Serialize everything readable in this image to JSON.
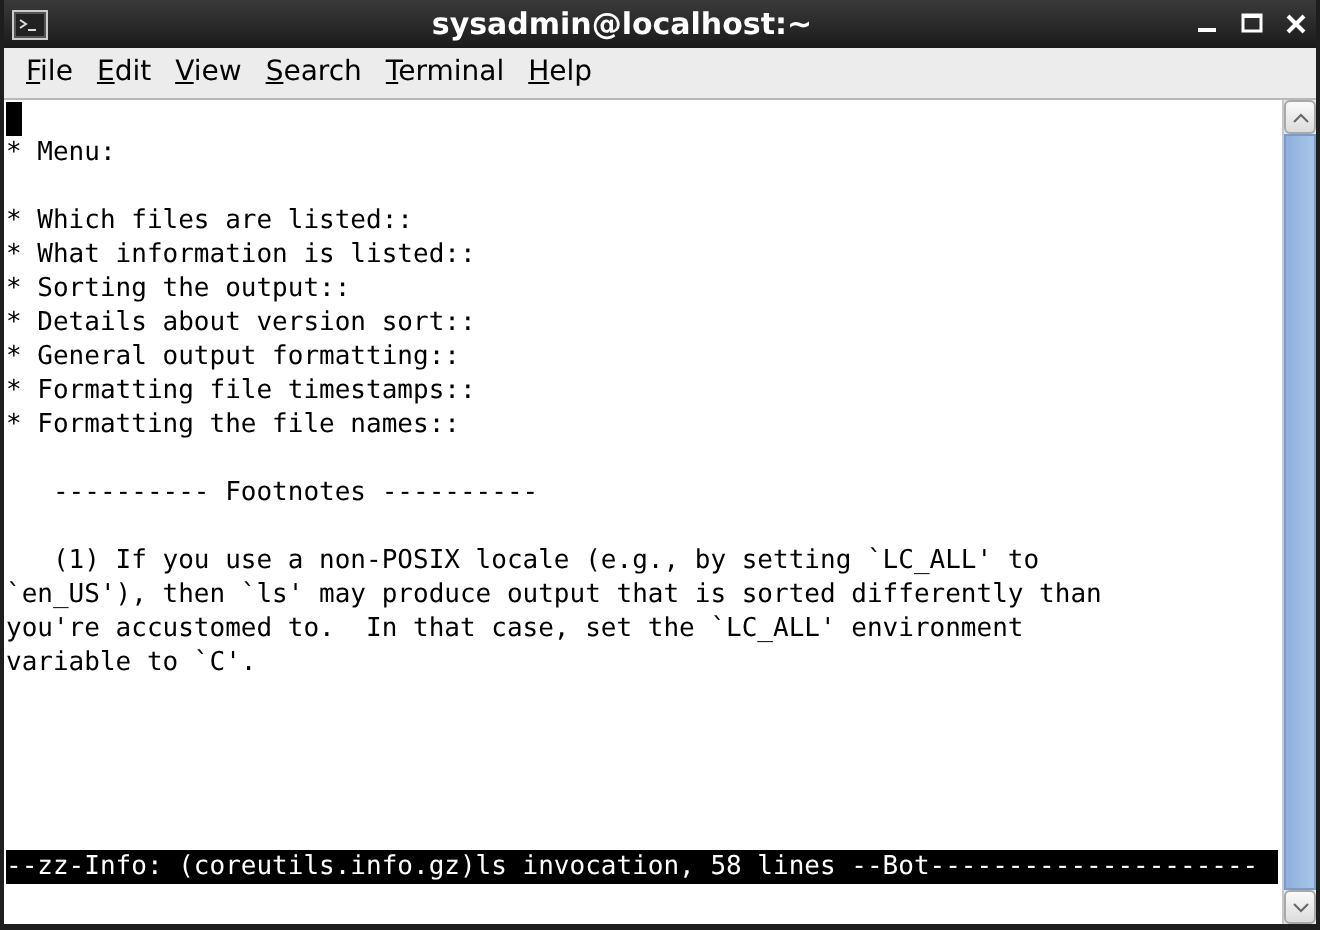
{
  "window": {
    "title": "sysadmin@localhost:~"
  },
  "menu": [
    {
      "label": "File"
    },
    {
      "label": "Edit"
    },
    {
      "label": "View"
    },
    {
      "label": "Search"
    },
    {
      "label": "Terminal"
    },
    {
      "label": "Help"
    }
  ],
  "terminal": {
    "lines": [
      {
        "kind": "cursor"
      },
      {
        "kind": "text",
        "text": "* Menu:"
      },
      {
        "kind": "blank"
      },
      {
        "kind": "text",
        "text": "* Which files are listed::"
      },
      {
        "kind": "text",
        "text": "* What information is listed::"
      },
      {
        "kind": "text",
        "text": "* Sorting the output::"
      },
      {
        "kind": "text",
        "text": "* Details about version sort::"
      },
      {
        "kind": "text",
        "text": "* General output formatting::"
      },
      {
        "kind": "text",
        "text": "* Formatting file timestamps::"
      },
      {
        "kind": "text",
        "text": "* Formatting the file names::"
      },
      {
        "kind": "blank"
      },
      {
        "kind": "text",
        "text": "   ---------- Footnotes ----------"
      },
      {
        "kind": "blank"
      },
      {
        "kind": "text",
        "text": "   (1) If you use a non-POSIX locale (e.g., by setting `LC_ALL' to"
      },
      {
        "kind": "text",
        "text": "`en_US'), then `ls' may produce output that is sorted differently than"
      },
      {
        "kind": "text",
        "text": "you're accustomed to.  In that case, set the `LC_ALL' environment"
      },
      {
        "kind": "text",
        "text": "variable to `C'."
      }
    ],
    "status_line": "--zz-Info: (coreutils.info.gz)ls invocation, 58 lines --Bot---------------------"
  }
}
